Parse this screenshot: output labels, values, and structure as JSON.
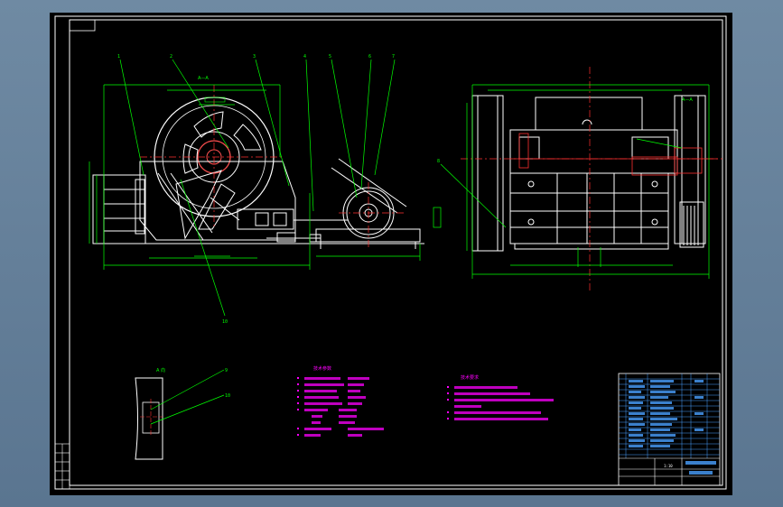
{
  "drawing": {
    "section_label": "A—A",
    "detail_label": "A 向",
    "spec_title": "技术参数",
    "req_title": "技术要求",
    "scale": "1:10",
    "colors": {
      "background": "#000000",
      "frame": "#ffffff",
      "part": "#ffffff",
      "dimension": "#00ff00",
      "leader": "#00ff00",
      "annotation": "#ff00ff",
      "centerline": "#ff0000",
      "title_block": "#4aa0ff"
    },
    "part_numbers": [
      "1",
      "2",
      "3",
      "4",
      "5",
      "6",
      "7",
      "8",
      "9",
      "10"
    ]
  }
}
